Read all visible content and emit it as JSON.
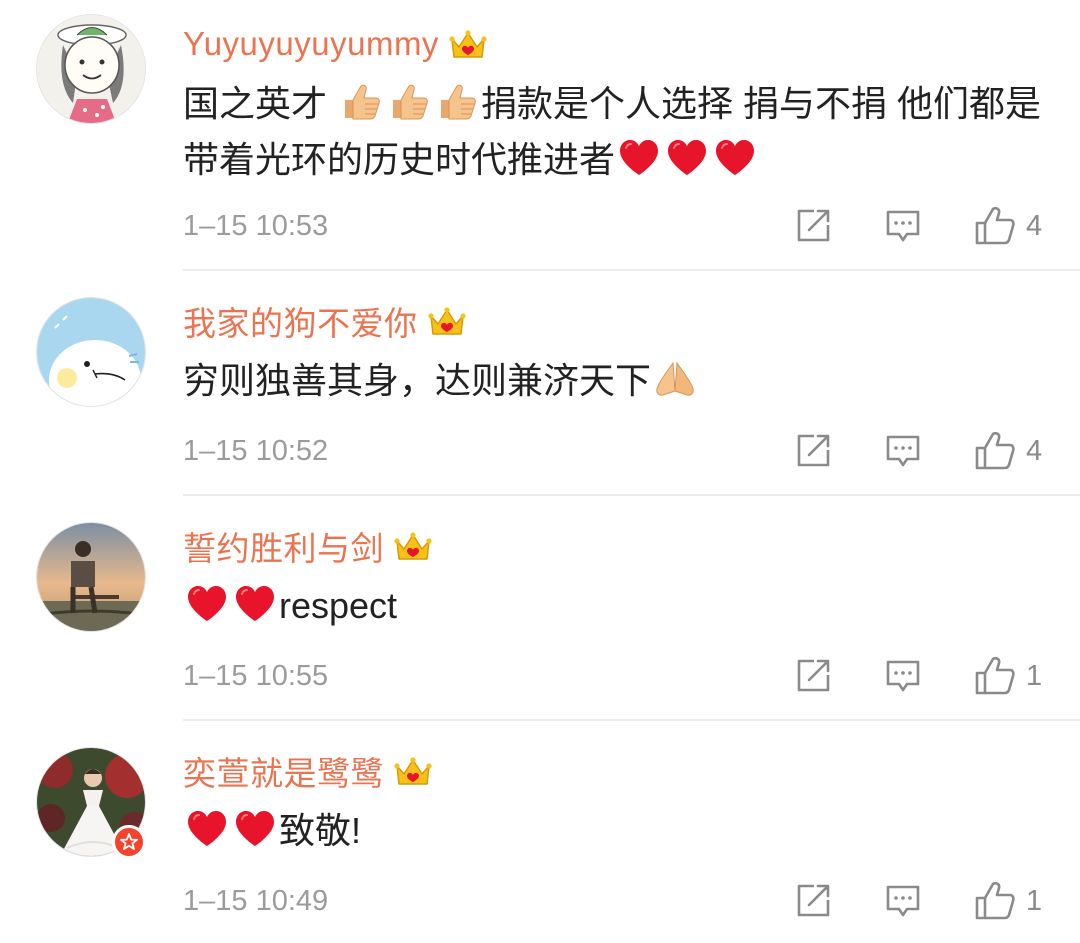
{
  "comments": [
    {
      "username": "Yuyuyuyuyummy",
      "text_parts": [
        "国之英才 ",
        "捐款是个人选择 捐与不捐 他们都是带着光环的历史时代推进者"
      ],
      "emoji": [
        "thumbs-up",
        "thumbs-up",
        "thumbs-up",
        "red-heart",
        "red-heart",
        "red-heart"
      ],
      "timestamp": "1–15 10:53",
      "likes": "4",
      "avatar_icon": "girl-drawing-avatar",
      "verified": false
    },
    {
      "username": "我家的狗不爱你",
      "text_parts": [
        "穷则独善其身，达则兼济天下"
      ],
      "emoji": [
        "folded-hands"
      ],
      "timestamp": "1–15 10:52",
      "likes": "4",
      "avatar_icon": "cartoon-bird-avatar",
      "verified": false
    },
    {
      "username": "誓约胜利与剑",
      "text_parts": [
        "respect"
      ],
      "emoji": [
        "red-heart",
        "red-heart"
      ],
      "timestamp": "1–15 10:55",
      "likes": "1",
      "avatar_icon": "sunset-photo-avatar",
      "verified": false
    },
    {
      "username": "奕萱就是鹭鹭",
      "text_parts": [
        "致敬!"
      ],
      "emoji": [
        "red-heart",
        "red-heart"
      ],
      "timestamp": "1–15 10:49",
      "likes": "1",
      "avatar_icon": "bride-photo-avatar",
      "verified": true
    }
  ],
  "icons": {
    "member_badge": "crown-icon",
    "repost": "repost-icon",
    "reply": "comment-icon",
    "like": "thumbs-up-icon",
    "verified": "verified-star-icon"
  },
  "colors": {
    "username": "#eb7350",
    "text": "#222222",
    "timestamp": "#9b9b9b",
    "icon": "#8a8a8a",
    "divider": "#ececec",
    "heart": "#e8142b",
    "verified_badge": "#f4422c"
  }
}
